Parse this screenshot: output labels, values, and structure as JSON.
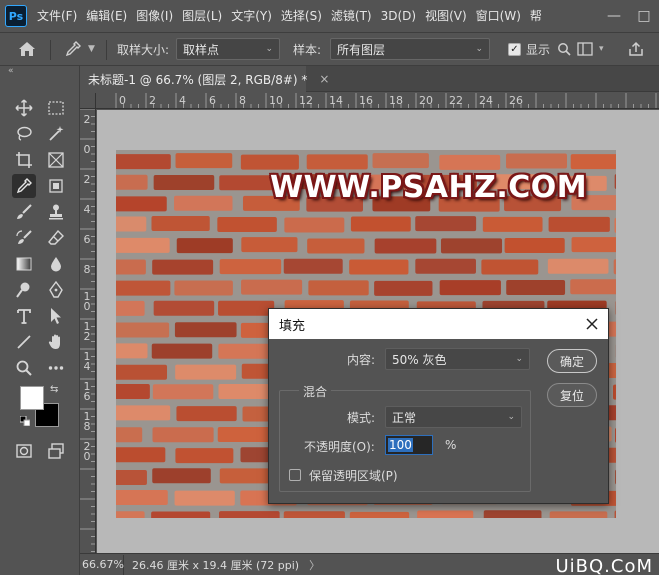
{
  "app": {
    "logo_text": "Ps"
  },
  "menu": [
    "文件(F)",
    "编辑(E)",
    "图像(I)",
    "图层(L)",
    "文字(Y)",
    "选择(S)",
    "滤镜(T)",
    "3D(D)",
    "视图(V)",
    "窗口(W)",
    "帮"
  ],
  "window_controls": {
    "minimize": "—",
    "maximize": "□"
  },
  "options": {
    "sample_size_label": "取样大小:",
    "sample_size_value": "取样点",
    "sample_label": "样本:",
    "sample_value": "所有图层",
    "show_ring_label": "显示"
  },
  "document": {
    "tab_title": "未标题-1 @ 66.7% (图层 2, RGB/8#) *",
    "tab_close": "×"
  },
  "rulers": {
    "horizontal": [
      "0",
      "2",
      "4",
      "6",
      "8",
      "10",
      "12",
      "14",
      "16",
      "18",
      "20",
      "22",
      "24",
      "26"
    ],
    "vertical": [
      "2",
      "0",
      "2",
      "4",
      "6",
      "8",
      "1\n0",
      "1\n2",
      "1\n4",
      "1\n6",
      "1\n8",
      "2\n0"
    ]
  },
  "canvas": {
    "watermark": "WWW.PSAHZ.COM"
  },
  "status": {
    "zoom": "66.67%",
    "doc_info": "26.46 厘米 x 19.4 厘米 (72 ppi)",
    "arrow": "〉",
    "site_logo": "UiBQ.CoM"
  },
  "fill_dialog": {
    "title": "填充",
    "contents_label": "内容:",
    "contents_value": "50% 灰色",
    "ok_label": "确定",
    "reset_label": "复位",
    "blending_legend": "混合",
    "mode_label": "模式:",
    "mode_value": "正常",
    "opacity_label": "不透明度(O):",
    "opacity_value": "100",
    "opacity_unit": "%",
    "preserve_label": "保留透明区域(P)"
  },
  "colors": {
    "ui_bg": "#535353",
    "foreground": "#ffffff",
    "background": "#000000",
    "watermark_outline": "#7a1717",
    "accent": "#2d6fbd"
  }
}
